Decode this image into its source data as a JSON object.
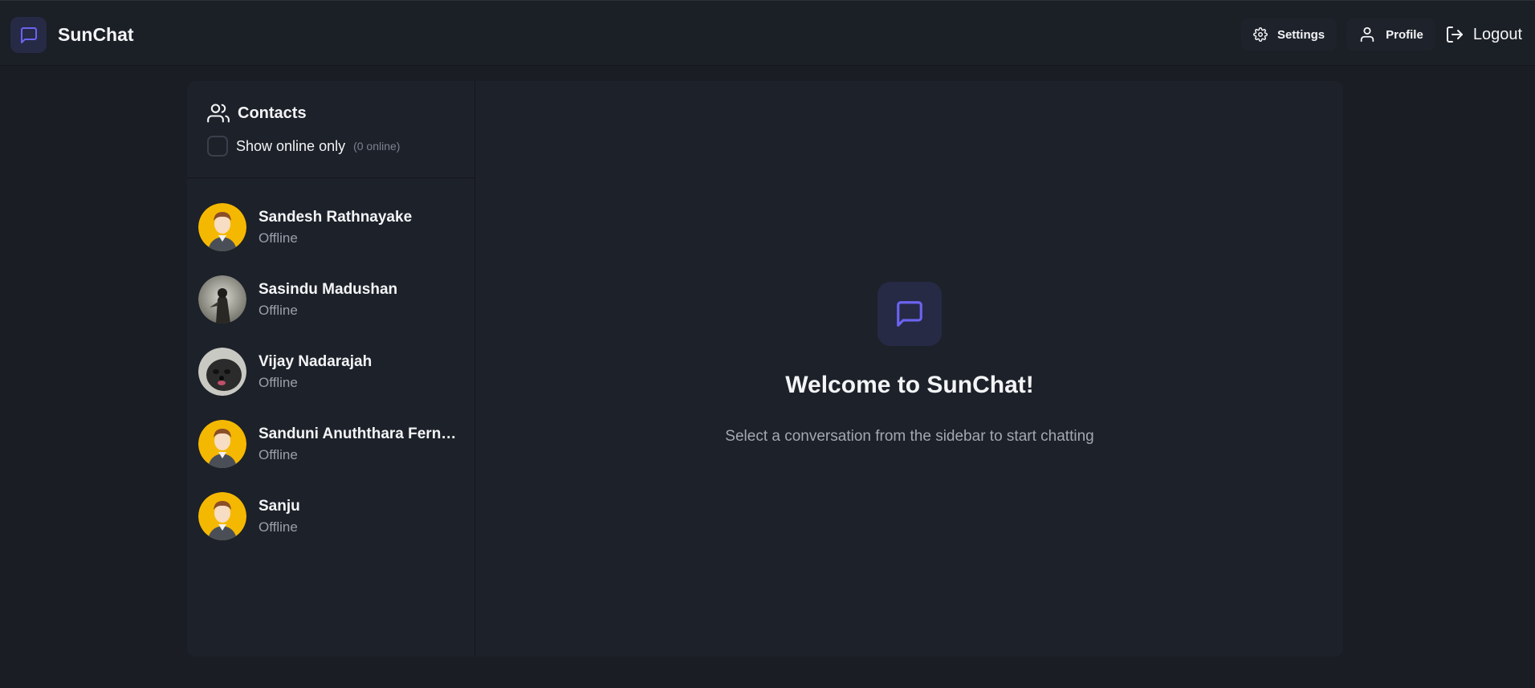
{
  "app": {
    "name": "SunChat",
    "accent_color": "#6b63f0",
    "brand_icon": "message-square-icon"
  },
  "nav": {
    "settings_label": "Settings",
    "profile_label": "Profile",
    "logout_label": "Logout"
  },
  "sidebar": {
    "title": "Contacts",
    "online_filter_label": "Show online only",
    "online_count": "(0 online)",
    "contacts": [
      {
        "name": "Sandesh Rathnayake",
        "status": "Offline",
        "avatar": "default-avatar"
      },
      {
        "name": "Sasindu Madushan",
        "status": "Offline",
        "avatar": "photo-avatar"
      },
      {
        "name": "Vijay Nadarajah",
        "status": "Offline",
        "avatar": "dog-photo-avatar"
      },
      {
        "name": "Sanduni Anuththara Fernando",
        "status": "Offline",
        "avatar": "default-avatar"
      },
      {
        "name": "Sanju",
        "status": "Offline",
        "avatar": "default-avatar"
      }
    ]
  },
  "welcome": {
    "title": "Welcome to SunChat!",
    "subtitle": "Select a conversation from the sidebar to start chatting"
  }
}
